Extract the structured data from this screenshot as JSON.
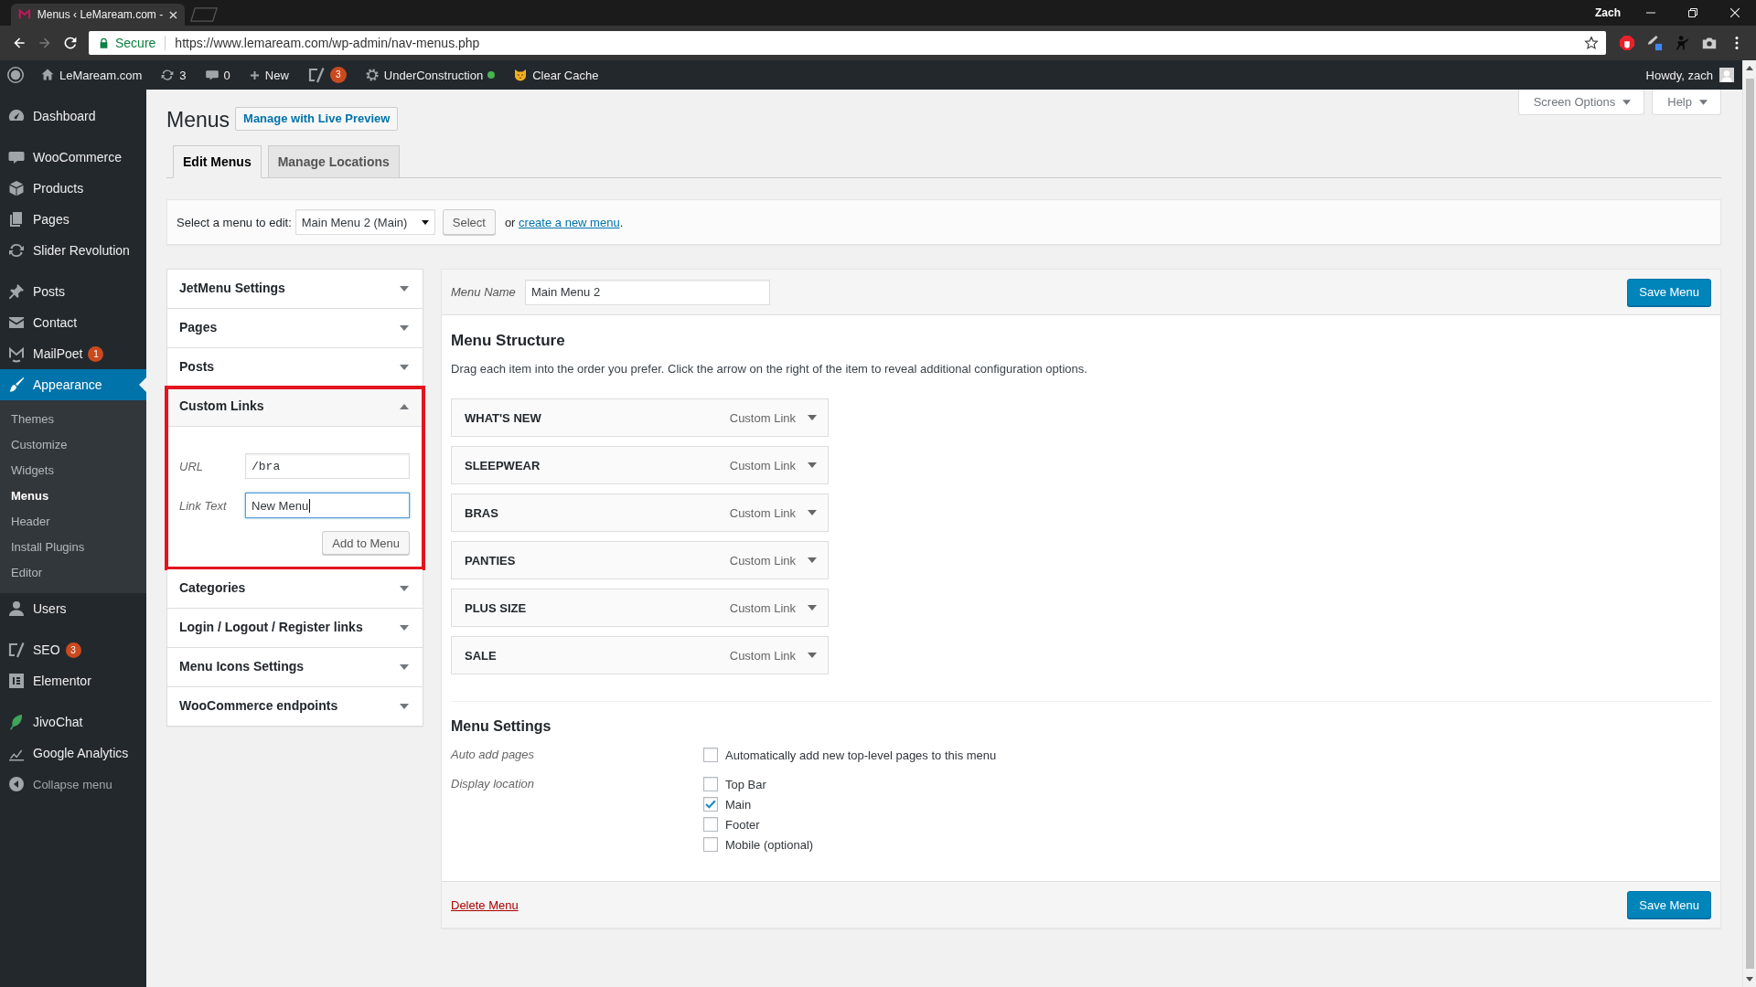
{
  "browser": {
    "tab": {
      "title": "Menus ‹ LeMaream.com -"
    },
    "profile": "Zach",
    "address": {
      "security": "Secure",
      "url": "https://www.lemaream.com/wp-admin/nav-menus.php"
    }
  },
  "admin_bar": {
    "items": [
      {
        "kind": "site",
        "label": "LeMaream.com"
      },
      {
        "kind": "updates",
        "label": "3"
      },
      {
        "kind": "comments",
        "label": "0"
      },
      {
        "kind": "new",
        "label": "New"
      },
      {
        "kind": "seo",
        "badge": "3"
      },
      {
        "kind": "status",
        "label": "UnderConstruction"
      },
      {
        "kind": "cache",
        "label": "Clear Cache"
      }
    ],
    "greeting": "Howdy, zach"
  },
  "sidebar": {
    "groups": [
      {
        "items": [
          {
            "kind": "dashboard",
            "label": "Dashboard",
            "selected": false
          }
        ]
      },
      {
        "items": [
          {
            "kind": "woocommerce",
            "label": "WooCommerce",
            "selected": false
          },
          {
            "kind": "products",
            "label": "Products",
            "selected": false
          },
          {
            "kind": "pages",
            "label": "Pages",
            "selected": false
          },
          {
            "kind": "slider",
            "label": "Slider Revolution",
            "selected": false
          }
        ]
      },
      {
        "items": [
          {
            "kind": "posts",
            "label": "Posts",
            "selected": false
          },
          {
            "kind": "contact",
            "label": "Contact",
            "selected": false
          },
          {
            "kind": "mailpoet",
            "label": "MailPoet",
            "badge": "1",
            "selected": false
          },
          {
            "kind": "appearance",
            "label": "Appearance",
            "selected": true,
            "submenu": [
              {
                "label": "Themes",
                "selected": false
              },
              {
                "label": "Customize",
                "selected": false
              },
              {
                "label": "Widgets",
                "selected": false
              },
              {
                "label": "Menus",
                "selected": true
              },
              {
                "label": "Header",
                "selected": false
              },
              {
                "label": "Install Plugins",
                "selected": false
              },
              {
                "label": "Editor",
                "selected": false
              }
            ]
          },
          {
            "kind": "users",
            "label": "Users",
            "selected": false
          }
        ]
      },
      {
        "items": [
          {
            "kind": "seo",
            "label": "SEO",
            "badge": "3",
            "selected": false
          },
          {
            "kind": "elementor",
            "label": "Elementor",
            "selected": false
          }
        ]
      },
      {
        "items": [
          {
            "kind": "jivochat",
            "label": "JivoChat",
            "selected": false
          },
          {
            "kind": "analytics",
            "label": "Google Analytics",
            "selected": false
          },
          {
            "kind": "collapse",
            "label": "Collapse menu",
            "selected": false
          }
        ]
      }
    ]
  },
  "page": {
    "title": "Menus",
    "title_action": "Manage with Live Preview",
    "screen_links": [
      "Screen Options",
      "Help"
    ],
    "tabs": [
      {
        "label": "Edit Menus",
        "selected": true
      },
      {
        "label": "Manage Locations",
        "selected": false
      }
    ],
    "menu_picker": {
      "label": "Select a menu to edit:",
      "value": "Main Menu 2 (Main)",
      "button": "Select",
      "note_before": "or",
      "link": "create a new menu",
      "note_after": "."
    }
  },
  "add_panels": [
    {
      "title": "JetMenu Settings",
      "expanded": false,
      "highlighted": false
    },
    {
      "title": "Pages",
      "expanded": false,
      "highlighted": false
    },
    {
      "title": "Posts",
      "expanded": false,
      "highlighted": false
    },
    {
      "title": "Custom Links",
      "expanded": true,
      "highlighted": true,
      "fields": [
        {
          "kind": "url",
          "label": "URL",
          "value": "/bra",
          "focused": false
        },
        {
          "kind": "text",
          "label": "Link Text",
          "value": "New Menu",
          "focused": true
        }
      ],
      "button": "Add to Menu"
    },
    {
      "title": "Categories",
      "expanded": false,
      "highlighted": false
    },
    {
      "title": "Login / Logout / Register links",
      "expanded": false,
      "highlighted": false
    },
    {
      "title": "Menu Icons Settings",
      "expanded": false,
      "highlighted": false
    },
    {
      "title": "WooCommerce endpoints",
      "expanded": false,
      "highlighted": false
    }
  ],
  "menu_editor": {
    "name_label": "Menu Name",
    "name_value": "Main Menu 2",
    "save_top": "Save Menu",
    "structure_title": "Menu Structure",
    "structure_hint": "Drag each item into the order you prefer. Click the arrow on the right of the item to reveal additional configuration options.",
    "items": [
      {
        "title": "WHAT'S NEW",
        "type": "Custom Link"
      },
      {
        "title": "SLEEPWEAR",
        "type": "Custom Link"
      },
      {
        "title": "BRAS",
        "type": "Custom Link"
      },
      {
        "title": "PANTIES",
        "type": "Custom Link"
      },
      {
        "title": "PLUS SIZE",
        "type": "Custom Link"
      },
      {
        "title": "SALE",
        "type": "Custom Link"
      }
    ],
    "settings_title": "Menu Settings",
    "settings": [
      {
        "label": "Auto add pages",
        "options": [
          {
            "label": "Automatically add new top-level pages to this menu",
            "checked": false
          }
        ]
      },
      {
        "label": "Display location",
        "options": [
          {
            "label": "Top Bar",
            "checked": false
          },
          {
            "label": "Main",
            "checked": true
          },
          {
            "label": "Footer",
            "checked": false
          },
          {
            "label": "Mobile (optional)",
            "checked": false
          }
        ]
      }
    ],
    "delete": "Delete Menu",
    "save_bottom": "Save Menu"
  }
}
